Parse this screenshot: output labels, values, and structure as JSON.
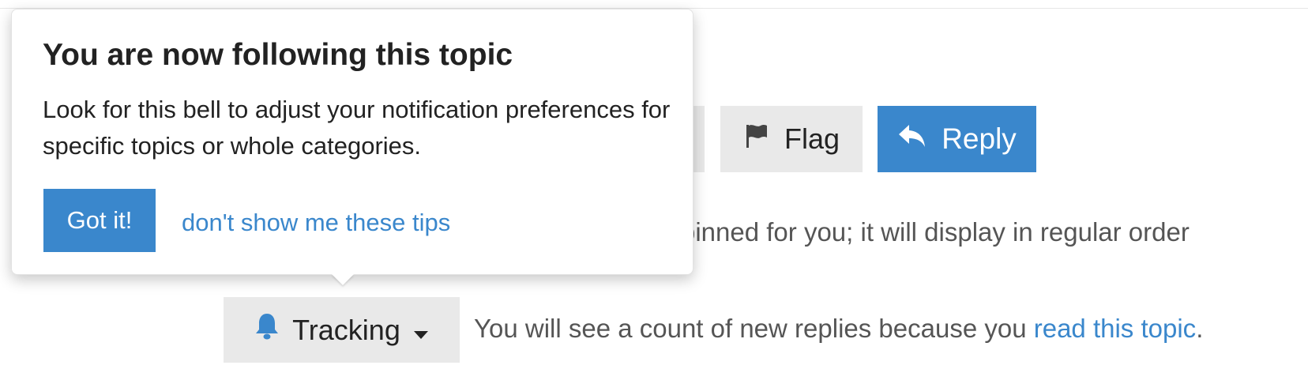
{
  "actions": {
    "flag_label": "Flag",
    "reply_label": "Reply"
  },
  "pinned_notice": {
    "visible_text": "pinned for you; it will display in regular order"
  },
  "notification": {
    "level_label": "Tracking",
    "description_prefix": "You will see a count of new replies because you ",
    "description_link": "read this topic",
    "description_suffix": "."
  },
  "popup": {
    "title": "You are now following this topic",
    "body": "Look for this bell to adjust your notification preferences for specific topics or whole categories.",
    "confirm_label": "Got it!",
    "dismiss_label": "don't show me these tips"
  },
  "colors": {
    "accent": "#3a87cc",
    "button_gray": "#e9e9e9",
    "text_primary": "#222222",
    "text_secondary": "#555555"
  },
  "icons": {
    "flag": "flag-icon",
    "reply": "reply-icon",
    "bell": "bell-icon",
    "caret": "caret-down-icon"
  }
}
